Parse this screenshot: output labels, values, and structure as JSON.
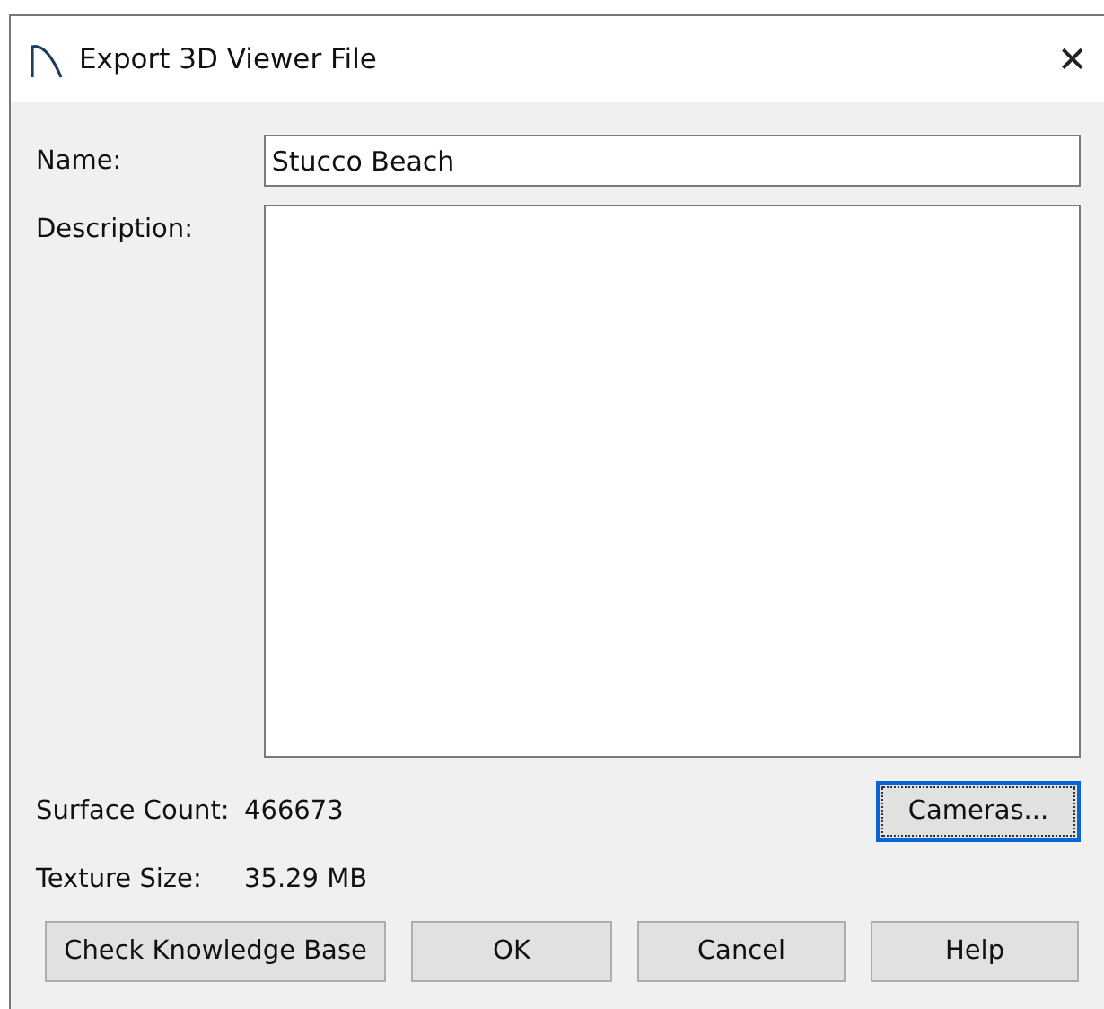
{
  "window": {
    "title": "Export 3D Viewer File",
    "close": "✕"
  },
  "name": {
    "label": "Name:",
    "value": "Stucco Beach"
  },
  "description": {
    "label": "Description:"
  },
  "surface_count": {
    "label": "Surface Count:",
    "value": "466673"
  },
  "cameras_button": {
    "label": "Cameras...",
    "focused": true
  },
  "texture_size": {
    "label": "Texture Size:",
    "value": "35.29 MB"
  },
  "buttons": [
    {
      "label": "Check Knowledge Base",
      "focused": false
    },
    {
      "label": "OK",
      "focused": false
    },
    {
      "label": "Cancel",
      "focused": false
    },
    {
      "label": "Help",
      "focused": false
    }
  ]
}
